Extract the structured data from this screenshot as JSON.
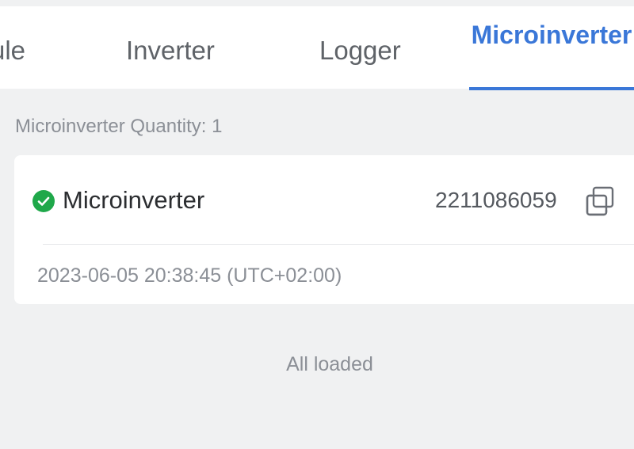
{
  "tabs": [
    {
      "label": "ule",
      "active": false
    },
    {
      "label": "Inverter",
      "active": false
    },
    {
      "label": "Logger",
      "active": false
    },
    {
      "label": "Microinverter",
      "active": true
    }
  ],
  "colors": {
    "accent": "#3a77d8",
    "online": "#1fa84a",
    "background": "#f0f1f2"
  },
  "summary": {
    "quantity_text": "Microinverter Quantity: 1"
  },
  "device": {
    "status": "online",
    "status_icon": "check-circle-icon",
    "name": "Microinverter",
    "serial": "2211086059",
    "copy_icon": "copy-icon",
    "timestamp": "2023-06-05 20:38:45 (UTC+02:00)"
  },
  "footer": {
    "status_text": "All loaded"
  }
}
